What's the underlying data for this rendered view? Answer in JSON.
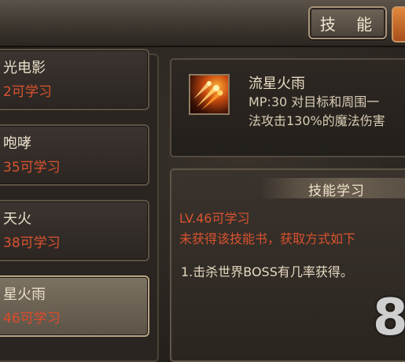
{
  "header": {
    "tab_skill_label": "技 能"
  },
  "skill_list": [
    {
      "name": "光电影",
      "requirement": "2可学习",
      "selected": false
    },
    {
      "name": "咆哮",
      "requirement": "35可学习",
      "selected": false
    },
    {
      "name": "天火",
      "requirement": "38可学习",
      "selected": false
    },
    {
      "name": "星火雨",
      "requirement": "46可学习",
      "selected": true
    }
  ],
  "detail": {
    "title": "流星火雨",
    "description_line1": "MP:30  对目标和周围一",
    "description_line2": "法攻击130%的魔法伤害",
    "icon": "meteor-fire-icon"
  },
  "learn": {
    "title": "技能学习",
    "level_requirement": "LV.46可学习",
    "book_status": "未获得该技能书，获取方式如下",
    "method": "1.击杀世界BOSS有几率获得。"
  },
  "overlay_number": "8",
  "colors": {
    "requirement_red": "#d9532f",
    "text_light": "#e9dfc9",
    "accent_orange": "#e0883c"
  }
}
